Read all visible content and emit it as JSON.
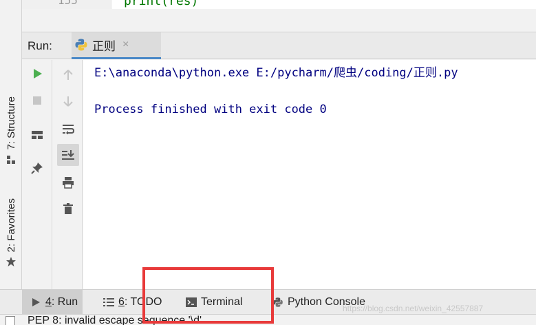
{
  "editor": {
    "line_number": "155",
    "code_line": "print(res)"
  },
  "sidebar": {
    "structure_label": "7: Structure",
    "favorites_label": "2: Favorites"
  },
  "run_panel": {
    "label": "Run:",
    "tab_title": "正则",
    "tab_close": "×",
    "toolbar_left": [
      "run-icon",
      "stop-icon",
      "layout-icon",
      "pin-icon"
    ],
    "toolbar_right": [
      "up-arrow-icon",
      "down-arrow-icon",
      "soft-wrap-icon",
      "scroll-to-end-icon",
      "print-icon",
      "trash-icon"
    ]
  },
  "console": {
    "lines": [
      "E:\\anaconda\\python.exe E:/pycharm/爬虫/coding/正则.py",
      "",
      "Process finished with exit code 0"
    ]
  },
  "bottom_tabs": [
    {
      "key": "4",
      "label": "Run",
      "icon": "run-triangle-icon",
      "active": true
    },
    {
      "key": "6",
      "label": "TODO",
      "icon": "list-icon",
      "active": false
    },
    {
      "key": "",
      "label": "Terminal",
      "icon": "terminal-icon",
      "active": false
    },
    {
      "key": "",
      "label": "Python Console",
      "icon": "python-icon",
      "active": false
    }
  ],
  "status": {
    "message": "PEP 8: invalid escape sequence '\\d'"
  },
  "watermark": "https://blog.csdn.net/weixin_42557887",
  "colors": {
    "accent": "#4a88c7",
    "console_text": "#000080",
    "run_green": "#4caf50",
    "highlight": "#e83a3a"
  }
}
